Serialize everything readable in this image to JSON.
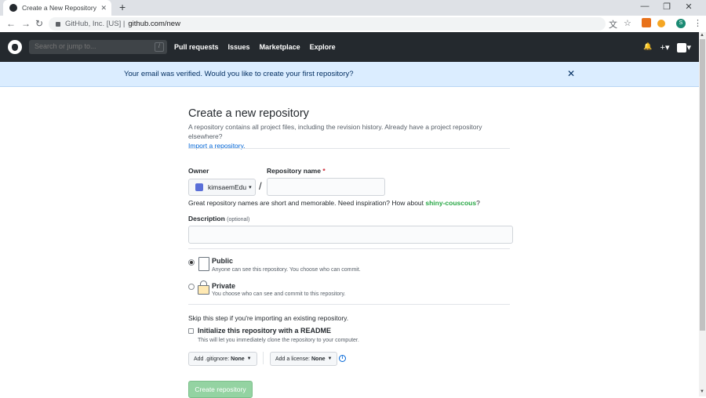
{
  "browser": {
    "tab_title": "Create a New Repository",
    "tab_close": "✕",
    "new_tab": "+",
    "win_min": "—",
    "win_max": "❐",
    "win_close": "✕",
    "back": "←",
    "forward": "→",
    "reload": "↻",
    "org_label": "GitHub, Inc. [US]  |",
    "url": "github.com/new",
    "profile_initial": "S",
    "menu": "⋮",
    "star": "☆",
    "translate": "文"
  },
  "header": {
    "search_placeholder": "Search or jump to...",
    "search_key": "/",
    "nav": [
      "Pull requests",
      "Issues",
      "Marketplace",
      "Explore"
    ],
    "bell": "🔔",
    "plus": "+▾",
    "avatar_caret": "▾"
  },
  "flash": {
    "message": "Your email was verified. Would you like to create your first repository?",
    "close": "✕"
  },
  "form": {
    "title": "Create a new repository",
    "subhead": "A repository contains all project files, including the revision history. Already have a project repository elsewhere?",
    "import_link": "Import a repository.",
    "owner_label": "Owner",
    "repo_name_label": "Repository name",
    "required_mark": "*",
    "owner_name": "kimsaemEdu",
    "owner_caret": "▾",
    "slash": "/",
    "hint_prefix": "Great repository names are short and memorable. Need inspiration? How about",
    "hint_suggestion": "shiny-couscous",
    "hint_suffix": "?",
    "description_label": "Description",
    "optional": "(optional)",
    "public_title": "Public",
    "public_desc": "Anyone can see this repository. You choose who can commit.",
    "private_title": "Private",
    "private_desc": "You choose who can see and commit to this repository.",
    "skip_text": "Skip this step if you're importing an existing repository.",
    "init_title": "Initialize this repository with a README",
    "init_desc": "This will let you immediately clone the repository to your computer.",
    "gitignore_label": "Add .gitignore:",
    "gitignore_value": "None",
    "license_label": "Add a license:",
    "license_value": "None",
    "info": "i",
    "create_button": "Create repository"
  }
}
